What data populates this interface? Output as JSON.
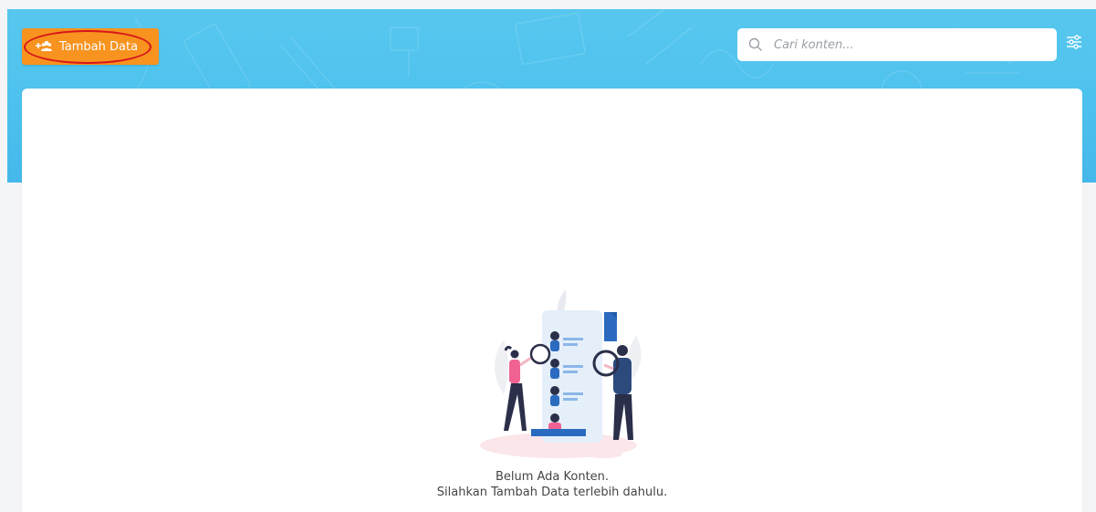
{
  "toolbar": {
    "add_button_label": "Tambah Data",
    "add_icon": "user-group-plus-icon",
    "search_placeholder": "Cari konten...",
    "search_icon": "search-icon",
    "filter_icon": "sliders-icon"
  },
  "empty_state": {
    "illustration": "empty-content-illustration",
    "title": "Belum Ada Konten.",
    "subtitle": "Silahkan Tambah Data terlebih dahulu."
  },
  "colors": {
    "header": "#4cc1ee",
    "add_button": "#f7931e",
    "annotation_ring": "#d8131b"
  }
}
